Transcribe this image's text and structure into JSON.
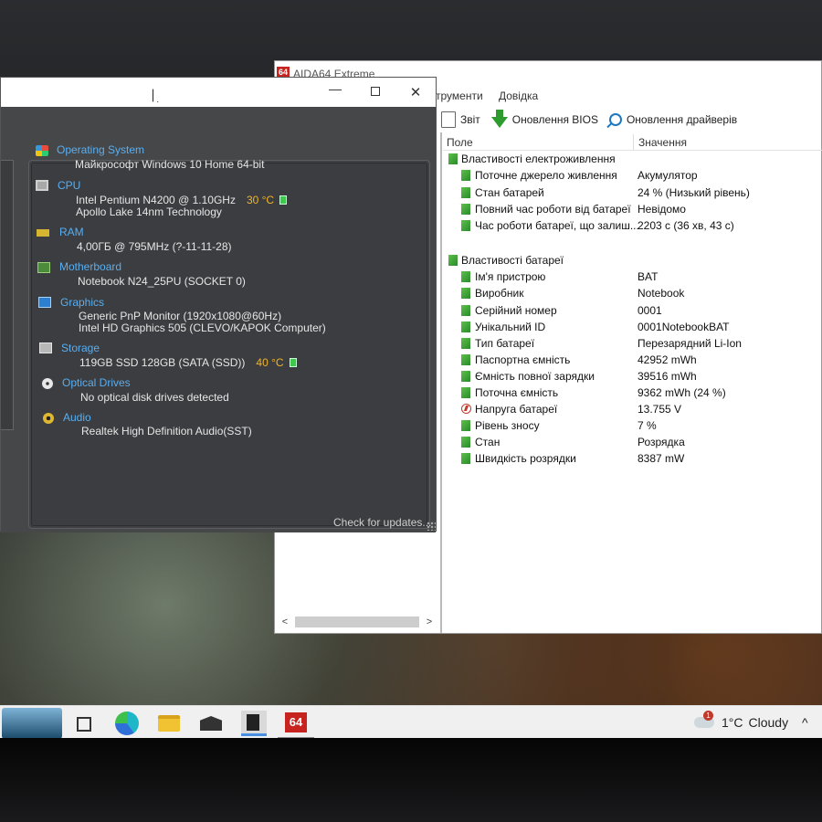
{
  "aida": {
    "logo": "64",
    "title": "AIDA64 Extreme",
    "menu": [
      "струменти",
      "Довідка"
    ],
    "toolbar": {
      "report": "Звіт",
      "bios": "Оновлення BIOS",
      "drivers": "Оновлення драйверів"
    },
    "columns": {
      "field": "Поле",
      "value": "Значення"
    },
    "groups": [
      {
        "title": "Властивості електроживлення",
        "items": [
          {
            "field": "Поточне джерело живлення",
            "value": "Акумулятор"
          },
          {
            "field": "Стан батарей",
            "value": "24 % (Низький рівень)"
          },
          {
            "field": "Повний час роботи від батареї",
            "value": "Невідомо"
          },
          {
            "field": "Час роботи батареї, що залиш...",
            "value": "2203 с (36 хв, 43 с)"
          }
        ]
      },
      {
        "title": "Властивості батареї",
        "items": [
          {
            "field": "Ім'я пристрою",
            "value": "BAT"
          },
          {
            "field": "Виробник",
            "value": "Notebook"
          },
          {
            "field": "Серійний номер",
            "value": "0001"
          },
          {
            "field": "Унікальний ID",
            "value": "0001NotebookBAT"
          },
          {
            "field": "Тип батареї",
            "value": "Перезарядний Li-Ion"
          },
          {
            "field": "Паспортна ємність",
            "value": "42952 mWh"
          },
          {
            "field": "Ємність повної зарядки",
            "value": "39516 mWh"
          },
          {
            "field": "Поточна ємність",
            "value": "9362 mWh  (24 %)"
          },
          {
            "field": "Напруга батареї",
            "value": "13.755 V"
          },
          {
            "field": "Рівень зносу",
            "value": "7 %"
          },
          {
            "field": "Стан",
            "value": "Розрядка"
          },
          {
            "field": "Швидкість розрядки",
            "value": "8387 mW"
          }
        ]
      }
    ],
    "scroll_left": "<",
    "scroll_right": ">"
  },
  "summary": {
    "window": {
      "minimize": "—",
      "maximize": "",
      "close": "✕"
    },
    "os": {
      "title": "Operating System",
      "line1": "Майкрософт Windows 10 Home 64-bit"
    },
    "cpu": {
      "title": "CPU",
      "line1": "Intel Pentium N4200 @ 1.10GHz",
      "temp": "30 °C",
      "line2": "Apollo Lake 14nm Technology"
    },
    "ram": {
      "title": "RAM",
      "line1": "4,00ГБ @ 795MHz (?-11-11-28)"
    },
    "motherboard": {
      "title": "Motherboard",
      "line1": "Notebook N24_25PU (SOCKET 0)"
    },
    "graphics": {
      "title": "Graphics",
      "line1": "Generic PnP Monitor (1920x1080@60Hz)",
      "line2": "Intel HD Graphics 505 (CLEVO/KAPOK Computer)"
    },
    "storage": {
      "title": "Storage",
      "line1": "119GB SSD 128GB (SATA (SSD))",
      "temp": "40 °C"
    },
    "optical": {
      "title": "Optical Drives",
      "line1": "No optical disk drives detected"
    },
    "audio": {
      "title": "Audio",
      "line1": "Realtek High Definition Audio(SST)"
    },
    "check_updates": "Check for updates..."
  },
  "taskbar": {
    "aida_label": "64",
    "weather": {
      "temp": "1°C",
      "condition": "Cloudy",
      "badge": "1"
    },
    "chevron": "^"
  }
}
